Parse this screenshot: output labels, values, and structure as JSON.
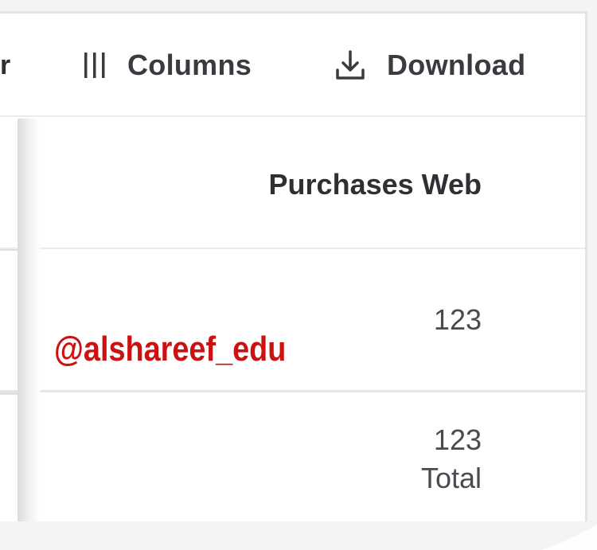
{
  "toolbar": {
    "partial_label": "r",
    "columns_label": "Columns",
    "download_label": "Download",
    "columns_icon": "columns-icon",
    "download_icon": "download-icon"
  },
  "table": {
    "columns": [
      "Purchases Web"
    ],
    "rows": [
      {
        "purchases_web": "123"
      }
    ],
    "total": {
      "value": "123",
      "label": "Total"
    }
  },
  "watermark": "@alshareef_edu",
  "colors": {
    "watermark": "#cc1111",
    "text": "#2f3034",
    "border": "#e4e4e7"
  }
}
